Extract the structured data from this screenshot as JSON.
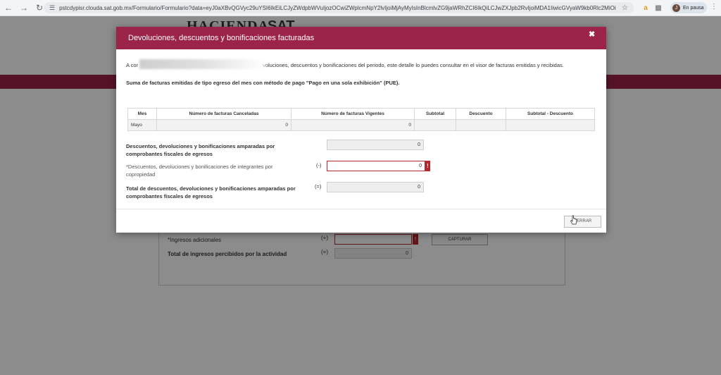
{
  "browser": {
    "url": "pstcdypisr.clouda.sat.gob.mx/Formulario/Formulario?data=eyJ0aXBvQ​GVyc29uYSI6IkEiLCJyZWdpbWVuIjozOCwiZWplcmNpY2lvIjoiMjAyMyIsInBlcmlvZG9jaWRhZCI6IkQiLCJwZXJpb2RvIjoiMDA1IiwicGVyaW9kb0Rlc2MiOiJNYXlvIiwiZmVjaGFFDY...",
    "profile_initial": "J",
    "profile_label": "En pausa",
    "icons": [
      "back-icon",
      "forward-icon",
      "reload-icon",
      "tune-icon",
      "star-icon",
      "amazon-icon",
      "extensions-icon",
      "kebab-icon"
    ]
  },
  "background_page": {
    "logo_hacienda": "HACIENDA",
    "logo_sat": "SAT",
    "ingresos_label": "*Ingresos adicionales",
    "ingresos_sign": "(+)",
    "capturar_label": "CAPTURAR",
    "total_label": "Total de ingresos percibidos por la actividad",
    "total_sign": "(=)",
    "total_value": "0",
    "error_glyph": "!"
  },
  "modal": {
    "title": "Devoluciones, descuentos y bonificaciones facturadas",
    "close_glyph": "✖",
    "intro_prefix": "A cor",
    "intro_suffix": "voluciones, descuentos y bonificaciones del periodo, este detalle lo puedes consultar en el visor de facturas emitidas y recibidas.",
    "subtitle": "Suma de facturas emitidas de tipo egreso del mes con método de pago \"Pago en una sola exhibición\" (PUE).",
    "table": {
      "headers": [
        "Mes",
        "Número de facturas Canceladas",
        "Número de facturas Vigentes",
        "Subtotal",
        "Descuento",
        "Subtotal - Descuento"
      ],
      "rows": [
        [
          "Mayo",
          "0",
          "0",
          "",
          "",
          ""
        ]
      ]
    },
    "fields": [
      {
        "label": "Descuentos, devoluciones y bonificaciones amparadas por comprobantes fiscales de egresos",
        "sign": "",
        "value": "0"
      },
      {
        "label": "*Descuentos, devoluciones y bonificaciones de integrantes por copropiedad",
        "sign": "(-)",
        "value": "0",
        "error_glyph": "!"
      },
      {
        "label": "Total de descuentos, devoluciones y bonificaciones amparadas por comprobantes fiscales de egresos",
        "sign": "(=)",
        "value": "0"
      }
    ],
    "close_button": "CERRAR"
  }
}
